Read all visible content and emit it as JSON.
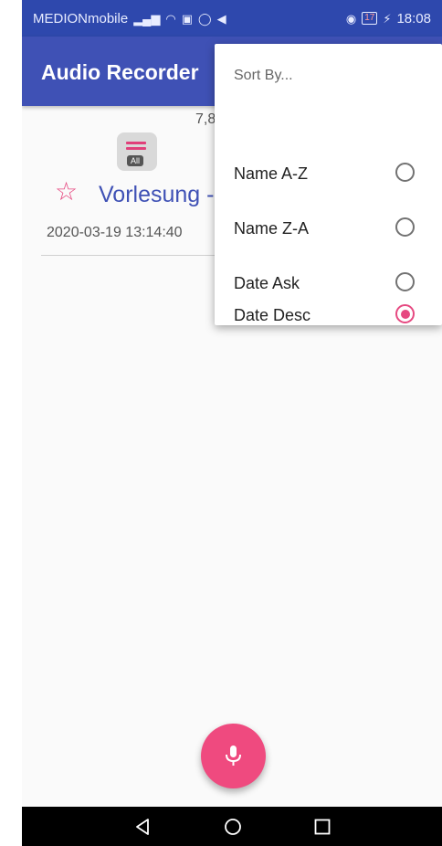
{
  "status_bar": {
    "carrier": "MEDIONmobile",
    "battery": "17",
    "time": "18:08"
  },
  "app_bar": {
    "title": "Audio Recorder"
  },
  "content": {
    "size_text": "7,8",
    "all_chip_label": "All",
    "recording": {
      "title": "Vorlesung -",
      "date": "2020-03-19 13:14:40"
    }
  },
  "sort_menu": {
    "header": "Sort By...",
    "options": [
      {
        "label": "Name A-Z",
        "selected": false
      },
      {
        "label": "Name Z-A",
        "selected": false
      },
      {
        "label": "Date Ask",
        "selected": false
      },
      {
        "label": "Date Desc",
        "selected": true
      }
    ]
  },
  "icons": {
    "fab": "microphone-icon",
    "nav": [
      "back-icon",
      "home-icon",
      "recents-icon"
    ]
  },
  "colors": {
    "primary": "#3f51b5",
    "status_bar": "#2e48ad",
    "accent": "#e64981"
  }
}
